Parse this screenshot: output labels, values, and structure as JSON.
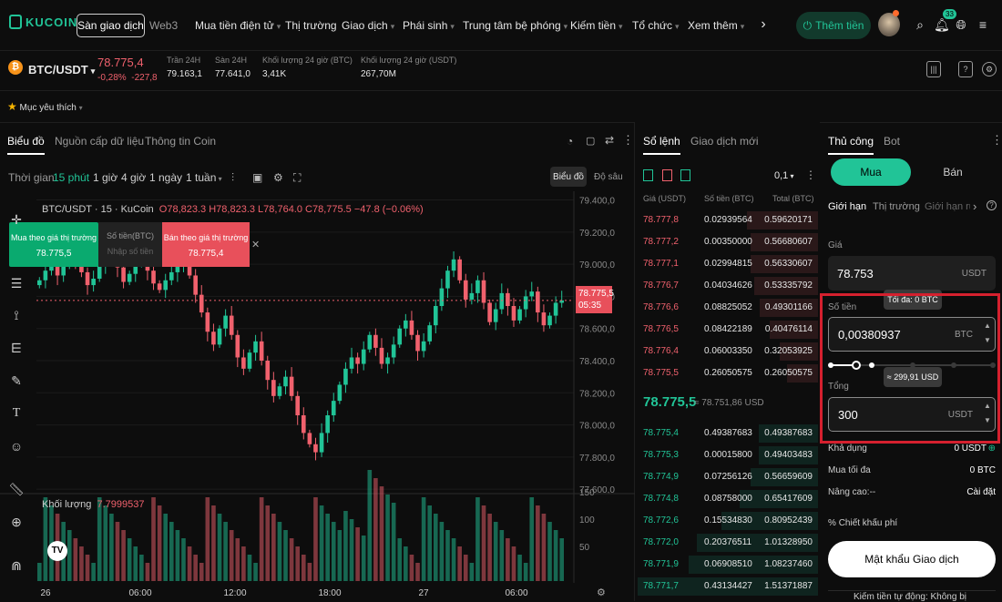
{
  "nav": {
    "logo": "KUCOIN",
    "tab_spot": "Sàn giao dịch",
    "tab_web3": "Web3",
    "items": [
      "Mua tiền điện tử",
      "Thị trường",
      "Giao dịch",
      "Phái sinh",
      "Trung tâm bệ phóng",
      "Kiếm tiền",
      "Tổ chức",
      "Xem thêm"
    ],
    "deposit": "Thêm tiền",
    "notif_count": "33"
  },
  "ticker": {
    "pair": "BTC/USDT",
    "price": "78.775,4",
    "change_pct": "-0,28%",
    "change_abs": "-227,8",
    "stats": [
      {
        "label": "Trần 24H",
        "value": "79.163,1"
      },
      {
        "label": "Sàn 24H",
        "value": "77.641,0"
      },
      {
        "label": "Khối lượng 24 giờ (BTC)",
        "value": "3,41K"
      },
      {
        "label": "Khối lượng 24 giờ (USDT)",
        "value": "267,70M"
      }
    ]
  },
  "favorites": "Mục yêu thích",
  "chart_panel": {
    "tabs": [
      "Biểu đồ",
      "Nguồn cấp dữ liệu",
      "Thông tin Coin"
    ],
    "time_label": "Thời gian",
    "timeframes": [
      "15 phút",
      "1 giờ",
      "4 giờ",
      "1 ngày",
      "1 tuần"
    ],
    "mode_chart": "Biểu đồ",
    "mode_depth": "Độ sâu",
    "ohlc_title": "BTC/USDT · 15 · KuCoin",
    "ohlc": "O78,823.3 H78,823.3 L78,764.0 C78,775.5 −47.8 (−0.06%)",
    "quick_buy_label": "Mua theo giá thị trường",
    "quick_buy_price": "78.775,5",
    "quick_qty_label": "Số tiền(BTC)",
    "quick_qty_placeholder": "Nhập số tiền",
    "quick_sell_label": "Bán theo giá thị trường",
    "quick_sell_price": "78.775,4",
    "volume_label": "Khối lượng",
    "volume_value": "7.7999537",
    "last_price_tag": "78.775,5",
    "countdown": "05:35"
  },
  "chart_data": {
    "type": "candlestick",
    "y_ticks": [
      "79.400,0",
      "79.200,0",
      "79.000,0",
      "78.800,0",
      "78.600,0",
      "78.400,0",
      "78.200,0",
      "78.000,0",
      "77.800,0",
      "77.600,0"
    ],
    "ylim": [
      77550,
      79420
    ],
    "vol_ticks": [
      "150",
      "100",
      "50"
    ],
    "x_ticks": [
      "26",
      "06:00",
      "12:00",
      "18:00",
      "27",
      "06:00"
    ],
    "series_close": [
      78900,
      78960,
      79010,
      78930,
      78990,
      79050,
      79020,
      78950,
      78870,
      78910,
      78990,
      79040,
      79060,
      78980,
      78890,
      78940,
      79010,
      79030,
      78960,
      78880,
      78840,
      78900,
      78950,
      78990,
      79000,
      78930,
      78810,
      78700,
      78580,
      78500,
      78600,
      78680,
      78560,
      78420,
      78350,
      78450,
      78520,
      78400,
      78280,
      78180,
      78240,
      78300,
      78180,
      78060,
      77950,
      77880,
      77830,
      77950,
      78060,
      78150,
      78250,
      78350,
      78420,
      78380,
      78470,
      78560,
      78480,
      78380,
      78420,
      78500,
      78600,
      78650,
      78560,
      78460,
      78520,
      78620,
      78740,
      78850,
      78960,
      79030,
      78900,
      78780,
      78820,
      78900,
      78760,
      78640,
      78720,
      78820,
      78740,
      78650,
      78720,
      78800,
      78830,
      78700,
      78620,
      78680,
      78760,
      78775
    ]
  },
  "orderbook": {
    "tabs": [
      "Sổ lệnh",
      "Giao dịch mới"
    ],
    "precision": "0,1",
    "headers": [
      "Giá (USDT)",
      "Số tiền (BTC)",
      "Total (BTC)"
    ],
    "asks": [
      [
        "78.777,8",
        "0.02939564",
        "0.59620171"
      ],
      [
        "78.777,2",
        "0.00350000",
        "0.56680607"
      ],
      [
        "78.777,1",
        "0.02994815",
        "0.56330607"
      ],
      [
        "78.776,7",
        "0.04034626",
        "0.53335792"
      ],
      [
        "78.776,6",
        "0.08825052",
        "0.49301166"
      ],
      [
        "78.776,5",
        "0.08422189",
        "0.40476114"
      ],
      [
        "78.776,4",
        "0.06003350",
        "0.32053925"
      ],
      [
        "78.775,5",
        "0.26050575",
        "0.26050575"
      ]
    ],
    "mid_price": "78.775,5",
    "mid_usd": "≈ 78.751,86 USD",
    "bids": [
      [
        "78.775,4",
        "0.49387683",
        "0.49387683"
      ],
      [
        "78.775,3",
        "0.00015800",
        "0.49403483"
      ],
      [
        "78.774,9",
        "0.07256126",
        "0.56659609"
      ],
      [
        "78.774,8",
        "0.08758000",
        "0.65417609"
      ],
      [
        "78.772,6",
        "0.15534830",
        "0.80952439"
      ],
      [
        "78.772,0",
        "0.20376511",
        "1.01328950"
      ],
      [
        "78.771,9",
        "0.06908510",
        "1.08237460"
      ],
      [
        "78.771,7",
        "0.43134427",
        "1.51371887"
      ]
    ]
  },
  "form": {
    "tabs": [
      "Thủ công",
      "Bot"
    ],
    "buy": "Mua",
    "sell": "Bán",
    "order_types": [
      "Giới hạn",
      "Thị trường",
      "Giới hạn rủi"
    ],
    "price_label": "Giá",
    "price_value": "78.753",
    "price_unit": "USDT",
    "amount_label": "Số tiền",
    "amount_tip": "Tối đa: 0 BTC",
    "amount_value": "0,00380937",
    "amount_unit": "BTC",
    "slider_fraction": 0.3,
    "total_tip": "≈ 299,91 USD",
    "total_label": "Tổng",
    "total_value": "300",
    "total_unit": "USDT",
    "available_label": "Khả dụng",
    "available_value": "0 USDT",
    "max_buy_label": "Mua tối đa",
    "max_buy_value": "0 BTC",
    "advanced_label": "Nâng cao:--",
    "advanced_value": "Cài đặt",
    "fee_label": "Chiết khấu phí",
    "password_button": "Mật khẩu Giao dịch",
    "bottom_note": "Kiếm tiền tự động: Không bị"
  },
  "colors": {
    "up": "#21c497",
    "down": "#f0616d",
    "accent": "#21c497",
    "highlight": "#d5202e"
  }
}
